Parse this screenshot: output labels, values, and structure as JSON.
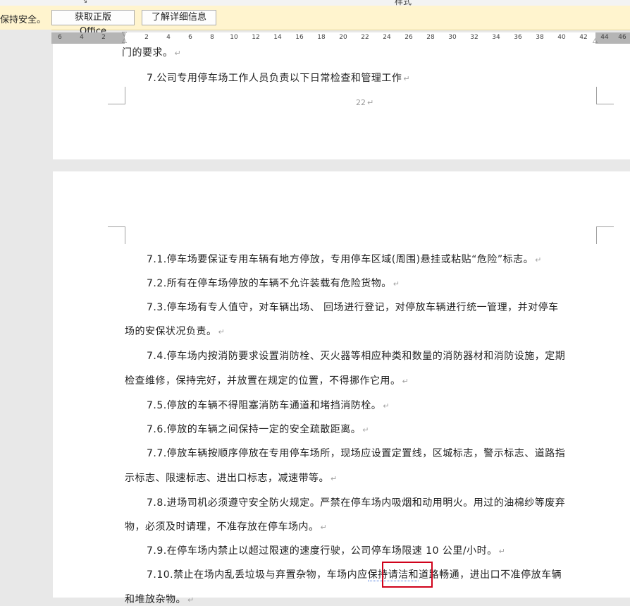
{
  "ribbon": {
    "styles_label": "样式",
    "launcher_glyph": "↘"
  },
  "message_bar": {
    "text": "保持安全。",
    "btn_get_office": "获取正版 Office",
    "btn_learn_more": "了解详细信息"
  },
  "ruler": {
    "ticks_left": [
      "6",
      "4",
      "2"
    ],
    "ticks_right": [
      "2",
      "4",
      "6",
      "8",
      "10",
      "12",
      "14",
      "16",
      "18",
      "20",
      "22",
      "24",
      "26",
      "28",
      "30",
      "32",
      "34",
      "36",
      "38",
      "40",
      "42",
      "44",
      "46"
    ]
  },
  "page1": {
    "partial_top": "门的要求。",
    "line_7": "7.公司专用停车场工作人员负责以下日常检查和管理工作",
    "page_number": "22"
  },
  "page2": {
    "l1": "7.1.停车场要保证专用车辆有地方停放，专用停车区域(周围)悬挂或粘贴“危险”标志。",
    "l2": "7.2.所有在停车场停放的车辆不允许装载有危险货物。",
    "l3a": "7.3.停车场有专人值守，对车辆出场、 回场进行登记，对停放车辆进行统一管理，并对停车",
    "l3b": "场的安保状况负责。",
    "l4a": "7.4.停车场内按消防要求设置消防栓、灭火器等相应种类和数量的消防器材和消防设施，定期",
    "l4b": "检查维修，保持完好，并放置在规定的位置，不得挪作它用。",
    "l5": "7.5.停放的车辆不得阻塞消防车通道和堵挡消防栓。",
    "l6": "7.6.停放的车辆之间保持一定的安全疏散距离。",
    "l7a": "7.7.停放车辆按顺序停放在专用停车场所，现场应设置定置线，区城标志，警示标志、道路指",
    "l7b": "示标志、限速标志、进出口标志，减速带等。",
    "l8a": "7.8.进场司机必须遵守安全防火规定。严禁在停车场内吸烟和动用明火。用过的油棉纱等废弃",
    "l8b": "物，必须及时请理，不准存放在停车场内。",
    "l9": "7.9.在停车场内禁止以超过限速的速度行驶，公司停车场限速 10 公里/小时。",
    "l10a_pre": "7.10.禁止在场内乱丢垃圾与弃置杂物，车场内应",
    "l10a_hl": "保持请洁和",
    "l10a_post": "道路畅通，进出口不准停放车辆",
    "l10b": "和堆放杂物。"
  },
  "paragraph_mark": "↵"
}
